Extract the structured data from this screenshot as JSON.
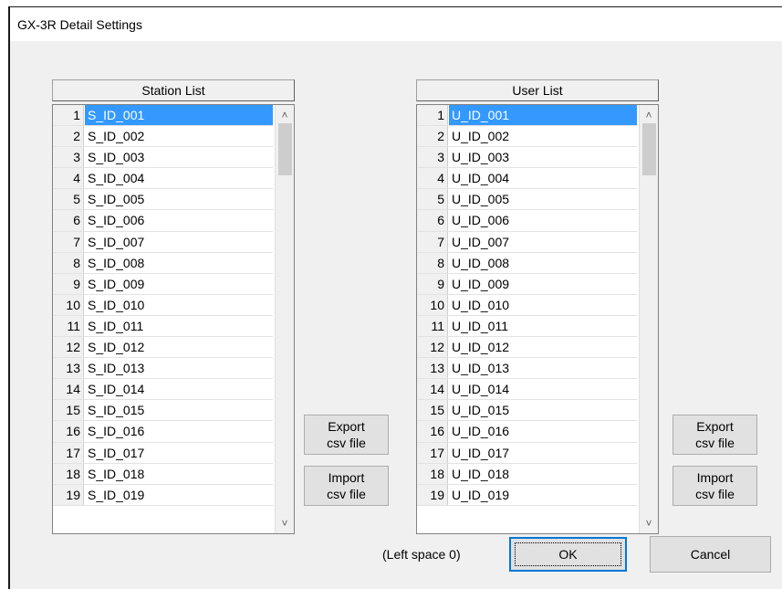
{
  "window": {
    "title": "GX-3R Detail Settings"
  },
  "station_list": {
    "header": "Station List",
    "selected_index": 0,
    "rows": [
      {
        "num": "1",
        "value": "S_ID_001"
      },
      {
        "num": "2",
        "value": "S_ID_002"
      },
      {
        "num": "3",
        "value": "S_ID_003"
      },
      {
        "num": "4",
        "value": "S_ID_004"
      },
      {
        "num": "5",
        "value": "S_ID_005"
      },
      {
        "num": "6",
        "value": "S_ID_006"
      },
      {
        "num": "7",
        "value": "S_ID_007"
      },
      {
        "num": "8",
        "value": "S_ID_008"
      },
      {
        "num": "9",
        "value": "S_ID_009"
      },
      {
        "num": "10",
        "value": "S_ID_010"
      },
      {
        "num": "11",
        "value": "S_ID_011"
      },
      {
        "num": "12",
        "value": "S_ID_012"
      },
      {
        "num": "13",
        "value": "S_ID_013"
      },
      {
        "num": "14",
        "value": "S_ID_014"
      },
      {
        "num": "15",
        "value": "S_ID_015"
      },
      {
        "num": "16",
        "value": "S_ID_016"
      },
      {
        "num": "17",
        "value": "S_ID_017"
      },
      {
        "num": "18",
        "value": "S_ID_018"
      },
      {
        "num": "19",
        "value": "S_ID_019"
      }
    ],
    "export_label_1": "Export",
    "export_label_2": "csv file",
    "import_label_1": "Import",
    "import_label_2": "csv file"
  },
  "user_list": {
    "header": "User List",
    "selected_index": 0,
    "rows": [
      {
        "num": "1",
        "value": "U_ID_001"
      },
      {
        "num": "2",
        "value": "U_ID_002"
      },
      {
        "num": "3",
        "value": "U_ID_003"
      },
      {
        "num": "4",
        "value": "U_ID_004"
      },
      {
        "num": "5",
        "value": "U_ID_005"
      },
      {
        "num": "6",
        "value": "U_ID_006"
      },
      {
        "num": "7",
        "value": "U_ID_007"
      },
      {
        "num": "8",
        "value": "U_ID_008"
      },
      {
        "num": "9",
        "value": "U_ID_009"
      },
      {
        "num": "10",
        "value": "U_ID_010"
      },
      {
        "num": "11",
        "value": "U_ID_011"
      },
      {
        "num": "12",
        "value": "U_ID_012"
      },
      {
        "num": "13",
        "value": "U_ID_013"
      },
      {
        "num": "14",
        "value": "U_ID_014"
      },
      {
        "num": "15",
        "value": "U_ID_015"
      },
      {
        "num": "16",
        "value": "U_ID_016"
      },
      {
        "num": "17",
        "value": "U_ID_017"
      },
      {
        "num": "18",
        "value": "U_ID_018"
      },
      {
        "num": "19",
        "value": "U_ID_019"
      }
    ],
    "export_label_1": "Export",
    "export_label_2": "csv file",
    "import_label_1": "Import",
    "import_label_2": "csv file"
  },
  "footer": {
    "status": "(Left space 0)",
    "ok_label": "OK",
    "cancel_label": "Cancel"
  },
  "icons": {
    "scroll_up": "chevron-up-icon",
    "scroll_down": "chevron-down-icon"
  },
  "colors": {
    "selection": "#3399ff",
    "focus_border": "#0078d7"
  }
}
